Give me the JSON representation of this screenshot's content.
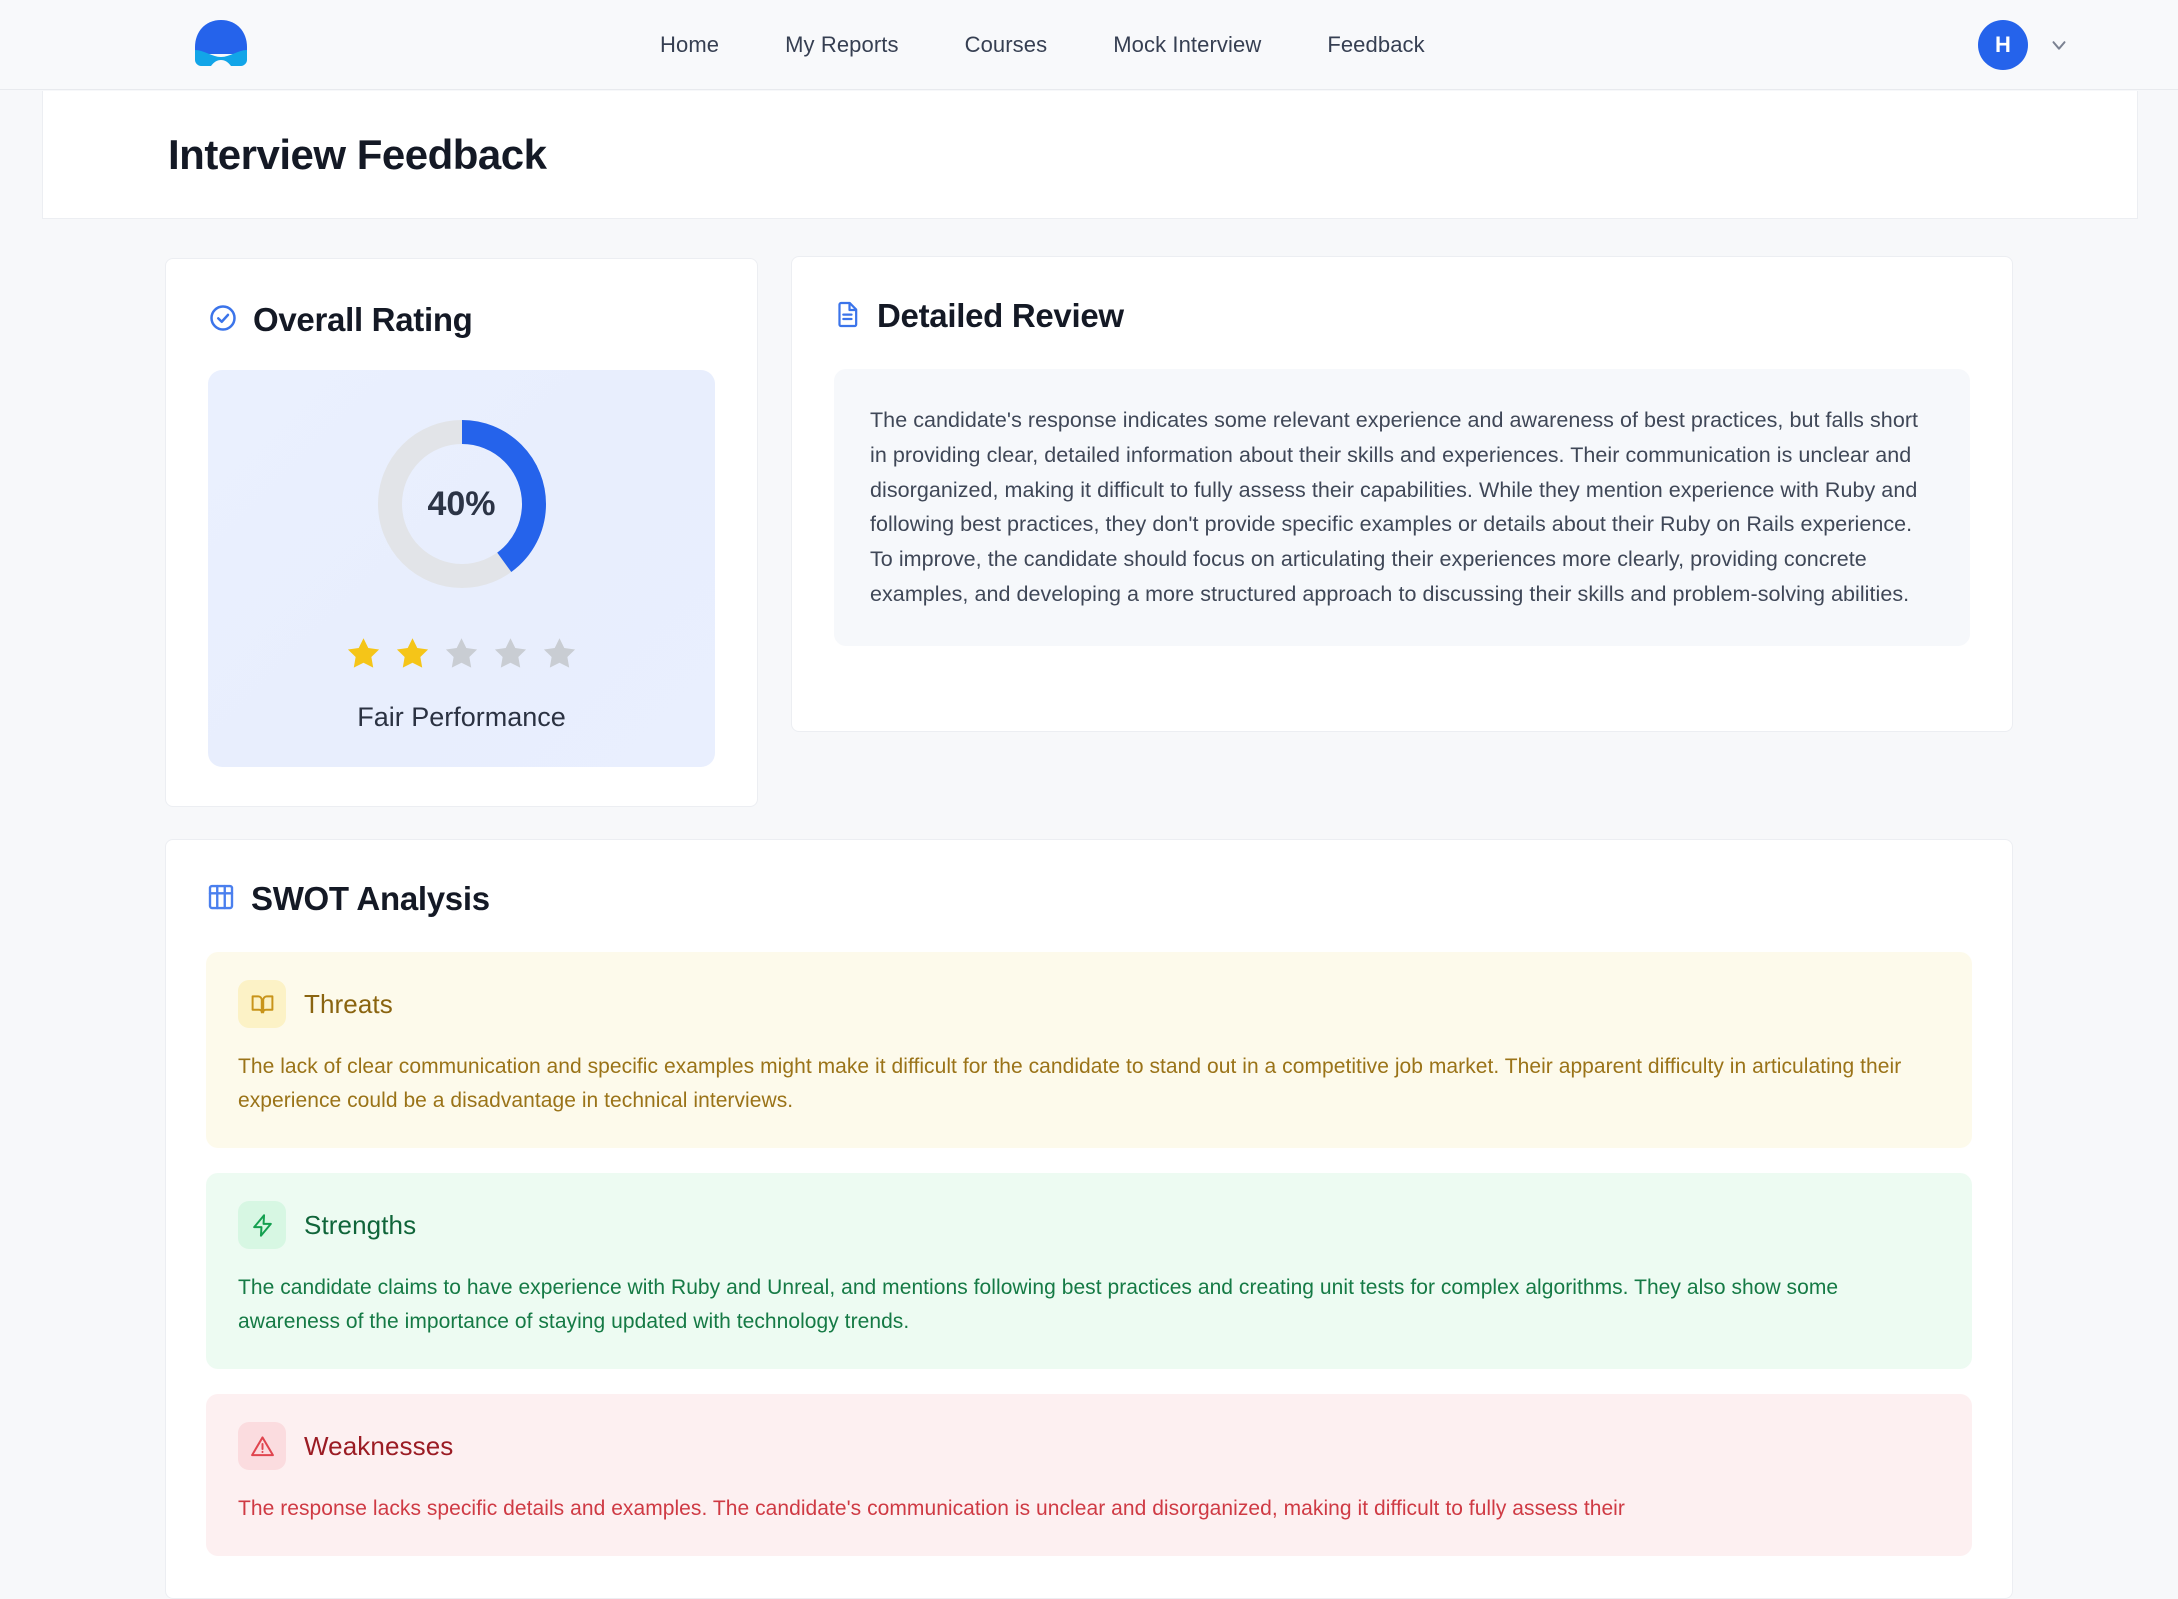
{
  "navbar": {
    "logo_name": "cap-logo",
    "links": [
      {
        "label": "Home"
      },
      {
        "label": "My Reports"
      },
      {
        "label": "Courses"
      },
      {
        "label": "Mock Interview"
      },
      {
        "label": "Feedback"
      }
    ],
    "user": {
      "initial": "H",
      "chevron": "chevron-down-icon"
    }
  },
  "page": {
    "title": "Interview Feedback"
  },
  "overall_rating": {
    "heading": "Overall Rating",
    "heading_icon": "check-circle-icon",
    "percent_label": "40%",
    "percent_value": 40,
    "stars_filled": 2,
    "stars_total": 5,
    "performance_label": "Fair Performance",
    "accent_color": "#2563eb",
    "track_color": "#e2e4e8",
    "star_filled_color": "#f5c518",
    "star_empty_color": "#c9cdd3"
  },
  "detailed_review": {
    "heading": "Detailed Review",
    "heading_icon": "document-icon",
    "body": "The candidate's response indicates some relevant experience and awareness of best practices, but falls short in providing clear, detailed information about their skills and experiences. Their communication is unclear and disorganized, making it difficult to fully assess their capabilities. While they mention experience with Ruby and following best practices, they don't provide specific examples or details about their Ruby on Rails experience. To improve, the candidate should focus on articulating their experiences more clearly, providing concrete examples, and developing a more structured approach to discussing their skills and problem-solving abilities."
  },
  "swot": {
    "heading": "SWOT Analysis",
    "heading_icon": "grid-table-icon",
    "items": [
      {
        "key": "threats",
        "title": "Threats",
        "icon": "open-book-icon",
        "body": "The lack of clear communication and specific examples might make it difficult for the candidate to stand out in a competitive job market. Their apparent difficulty in articulating their experience could be a disadvantage in technical interviews.",
        "bg_color": "#fdfaeb",
        "text_color": "#9a7318"
      },
      {
        "key": "strengths",
        "title": "Strengths",
        "icon": "lightning-bolt-icon",
        "body": "The candidate claims to have experience with Ruby and Unreal, and mentions following best practices and creating unit tests for complex algorithms. They also show some awareness of the importance of staying updated with technology trends.",
        "bg_color": "#edfbf2",
        "text_color": "#157a45"
      },
      {
        "key": "weaknesses",
        "title": "Weaknesses",
        "icon": "warning-triangle-icon",
        "body": "The response lacks specific details and examples. The candidate's communication is unclear and disorganized, making it difficult to fully assess their",
        "bg_color": "#fdf0f1",
        "text_color": "#cf3a44"
      }
    ]
  }
}
